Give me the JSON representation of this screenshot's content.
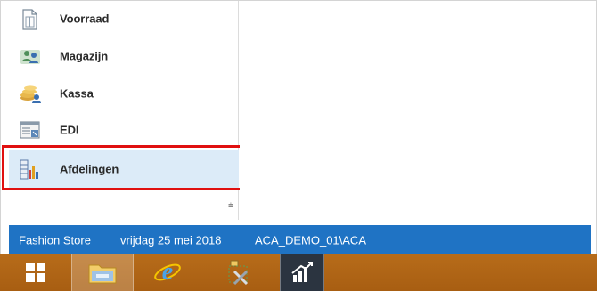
{
  "nav": {
    "items": [
      {
        "label": "Voorraad",
        "icon": "document-icon"
      },
      {
        "label": "Magazijn",
        "icon": "people-icon"
      },
      {
        "label": "Kassa",
        "icon": "coins-icon"
      },
      {
        "label": "EDI",
        "icon": "form-table-icon"
      },
      {
        "label": "Afdelingen",
        "icon": "bar-grid-icon",
        "selected": true
      }
    ],
    "more_glyph": "⩧"
  },
  "status": {
    "app_name": "Fashion Store",
    "date": "vrijdag 25 mei 2018",
    "user": "ACA_DEMO_01\\ACA"
  },
  "colors": {
    "status_bar": "#1f73c4",
    "taskbar": "#b06515",
    "selected_bg": "#dcebf8",
    "highlight": "#e01010"
  },
  "taskbar": {
    "buttons": [
      "windows-start-icon",
      "file-explorer-icon",
      "internet-explorer-icon",
      "tools-app-icon",
      "fashion-store-app-icon"
    ]
  }
}
